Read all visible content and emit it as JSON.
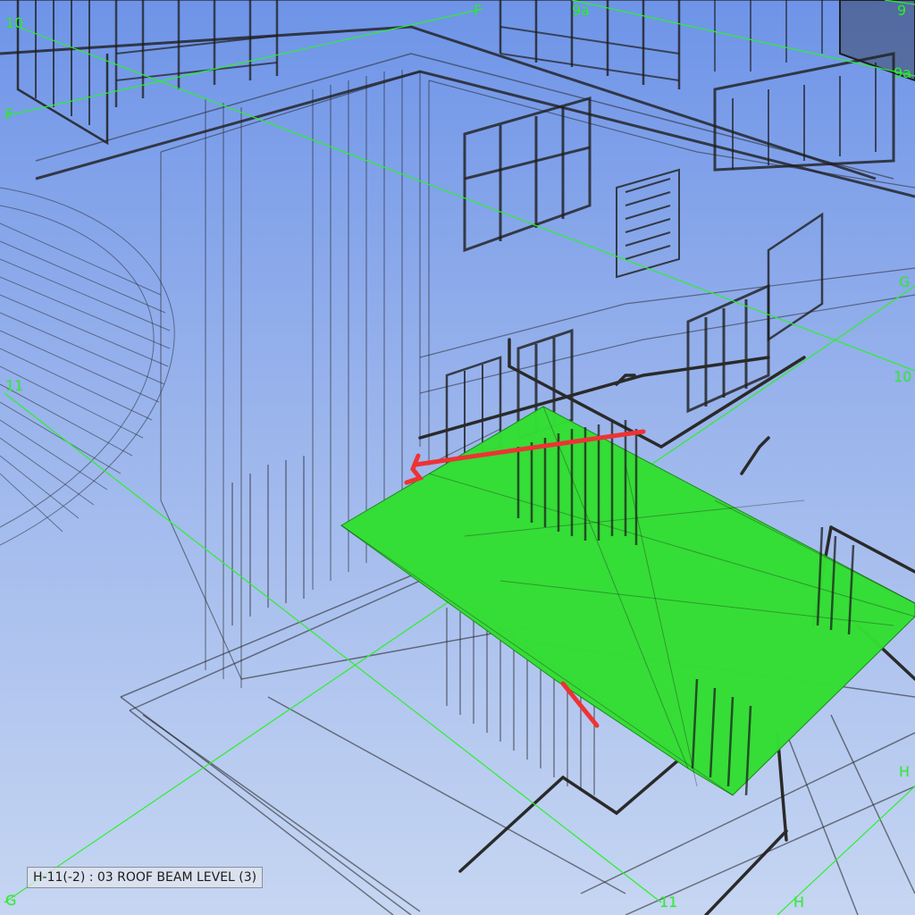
{
  "viewport": {
    "status_tag": "H-11(-2) : 03 ROOF BEAM LEVEL (3)",
    "grid_labels": {
      "top_f": "F",
      "top_9a": "9a",
      "corner_9": "9",
      "right_9a": "9a",
      "left_10": "10",
      "left_f": "F",
      "right_g": "G",
      "right_10": "10",
      "left_11": "11",
      "bottom_g": "G",
      "bottom_11": "11",
      "bottom_h": "H",
      "right_h": "H"
    },
    "colors": {
      "grid_line": "#2cf02c",
      "selected_slab": "#33dd33",
      "highlight_beam": "#ee3333",
      "wireframe": "#1e1e1e",
      "background_top": "#6e94e8",
      "background_bottom": "#c6d6f2"
    }
  }
}
